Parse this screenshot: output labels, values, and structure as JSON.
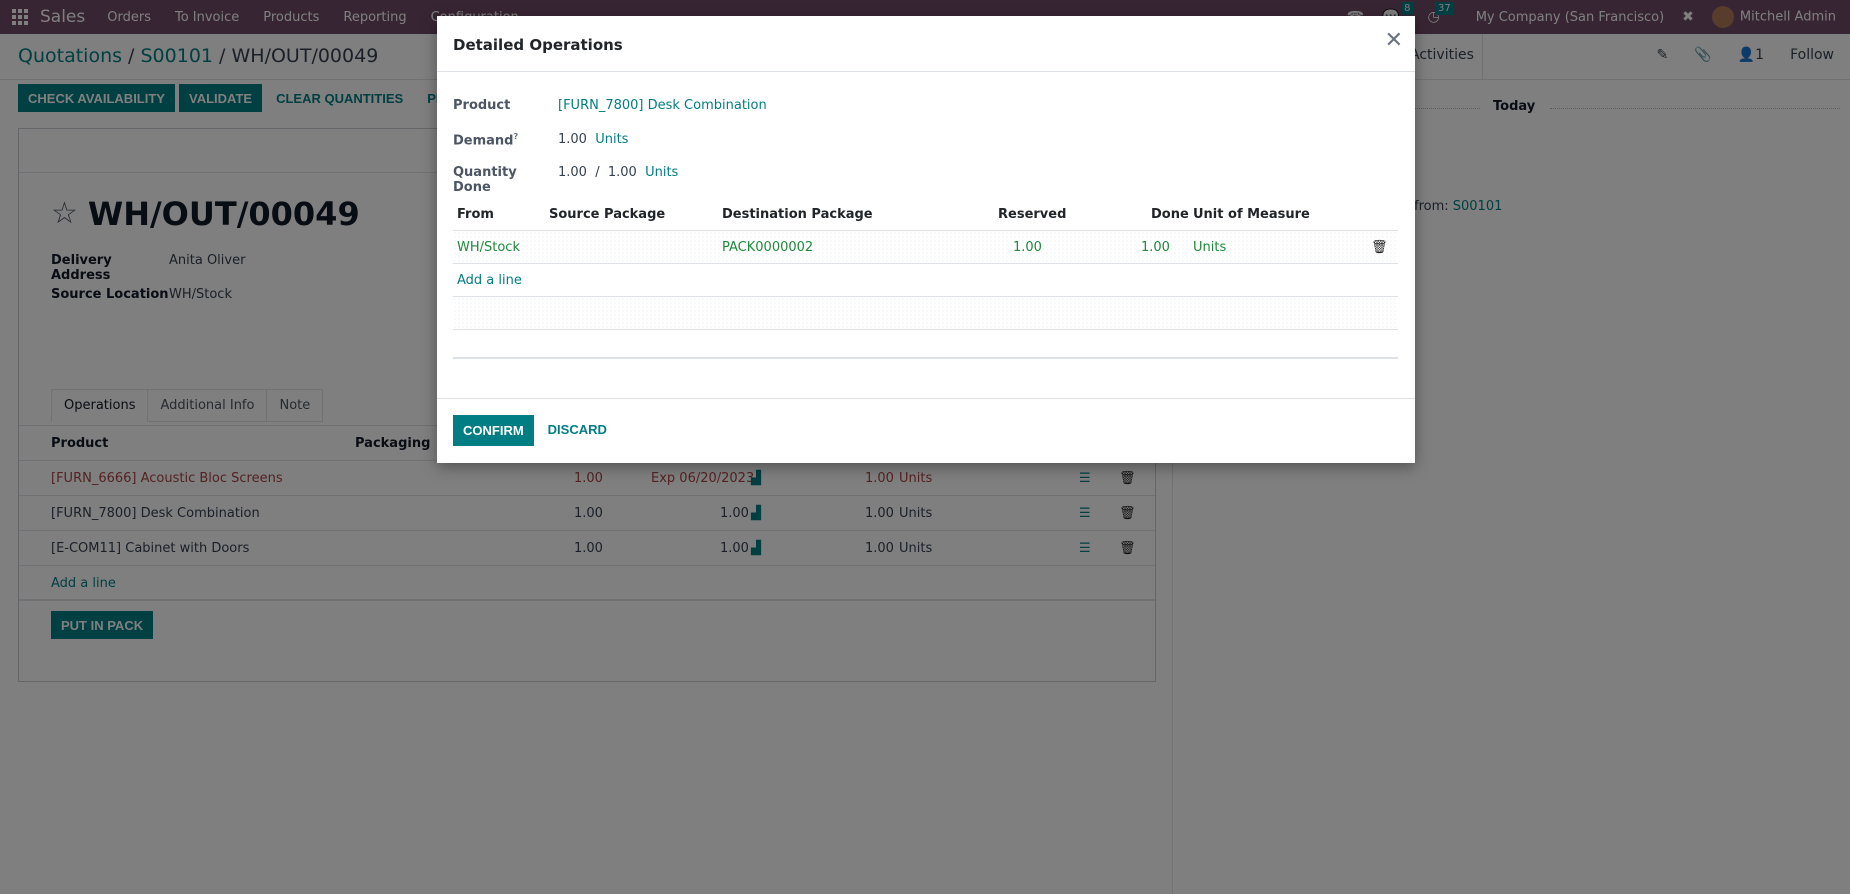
{
  "navbar": {
    "app_name": "Sales",
    "menu": [
      "Orders",
      "To Invoice",
      "Products",
      "Reporting",
      "Configuration"
    ],
    "messages_count": "8",
    "activities_count": "37",
    "company": "My Company (San Francisco)",
    "user": "Mitchell Admin"
  },
  "breadcrumb": {
    "level1": "Quotations",
    "sep": " / ",
    "level2": "S00101",
    "current": "WH/OUT/00049"
  },
  "chatter_top": {
    "activities": "Activities",
    "followers_count": "1",
    "follow": "Follow"
  },
  "toolbar": {
    "check_availability": "CHECK AVAILABILITY",
    "validate": "VALIDATE",
    "clear_quantities": "CLEAR QUANTITIES",
    "print": "PRINT"
  },
  "form": {
    "title": "WH/OUT/00049",
    "delivery_address_label": "Delivery Address",
    "delivery_address": "Anita Oliver",
    "source_location_label": "Source Location",
    "source_location": "WH/Stock",
    "tabs": [
      "Operations",
      "Additional Info",
      "Note"
    ],
    "columns": {
      "product": "Product",
      "packaging": "Packaging"
    },
    "rows": [
      {
        "product": "[FURN_6666] Acoustic Bloc Screens",
        "demand": "1.00",
        "forecast": "Exp 06/20/2023",
        "quantity": "1.00",
        "uom": "Units",
        "warning": true
      },
      {
        "product": "[FURN_7800] Desk Combination",
        "demand": "1.00",
        "forecast": "1.00",
        "quantity": "1.00",
        "uom": "Units",
        "warning": false
      },
      {
        "product": "[E-COM11] Cabinet with Doors",
        "demand": "1.00",
        "forecast": "1.00",
        "quantity": "1.00",
        "uom": "Units",
        "warning": false
      }
    ],
    "add_line": "Add a line",
    "put_in_pack": "PUT IN PACK"
  },
  "chatter": {
    "today": "Today",
    "from_prefix": "from: ",
    "from_link": "S00101"
  },
  "dialog": {
    "title": "Detailed Operations",
    "product_label": "Product",
    "product": "[FURN_7800] Desk Combination",
    "demand_label": "Demand",
    "demand_help": "?",
    "demand_qty": "1.00",
    "demand_uom": "Units",
    "qty_done_label": "Quantity Done",
    "qty_done": "1.00",
    "qty_sep": "/",
    "qty_total": "1.00",
    "qty_uom": "Units",
    "columns": {
      "from": "From",
      "source_package": "Source Package",
      "destination_package": "Destination Package",
      "reserved": "Reserved",
      "done": "Done",
      "uom": "Unit of Measure"
    },
    "lines": [
      {
        "from": "WH/Stock",
        "source_package": "",
        "destination_package": "PACK0000002",
        "reserved": "1.00",
        "done": "1.00",
        "uom": "Units"
      }
    ],
    "add_line": "Add a line",
    "confirm": "CONFIRM",
    "discard": "DISCARD"
  },
  "colors": {
    "brand": "#714b67",
    "accent": "#017e84",
    "warning_text": "#a94442",
    "done_line": "#1f8a3a"
  }
}
